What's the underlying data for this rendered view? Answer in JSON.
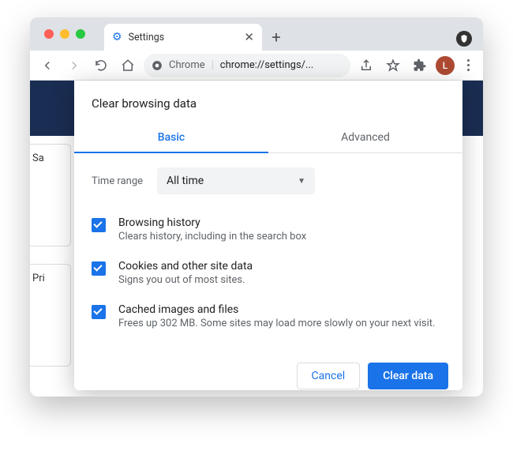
{
  "tab": {
    "title": "Settings"
  },
  "omnibox": {
    "host": "Chrome",
    "path": "chrome://settings/..."
  },
  "avatar_initial": "L",
  "bg": {
    "card1": "Sa",
    "card2": "Pri"
  },
  "modal": {
    "title": "Clear browsing data",
    "tabs": {
      "basic": "Basic",
      "advanced": "Advanced"
    },
    "time_range_label": "Time range",
    "time_range_value": "All time",
    "options": [
      {
        "heading": "Browsing history",
        "desc": "Clears history, including in the search box"
      },
      {
        "heading": "Cookies and other site data",
        "desc": "Signs you out of most sites."
      },
      {
        "heading": "Cached images and files",
        "desc": "Frees up 302 MB. Some sites may load more slowly on your next visit."
      }
    ],
    "cancel": "Cancel",
    "confirm": "Clear data"
  }
}
